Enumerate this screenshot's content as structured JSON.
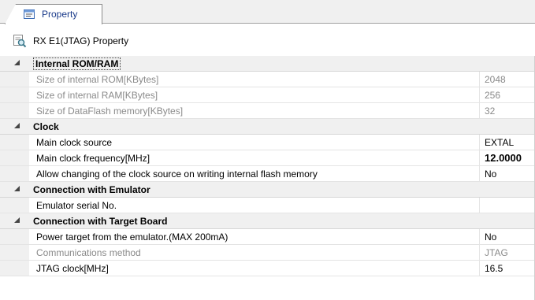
{
  "tab": {
    "label": "Property",
    "icon": "property-page-icon"
  },
  "header": {
    "title": "RX E1(JTAG) Property",
    "icon": "magnifier-property-icon"
  },
  "categories": [
    {
      "name": "Internal ROM/RAM",
      "items": [
        {
          "name": "Size of internal ROM[KBytes]",
          "value": "2048",
          "disabled": true
        },
        {
          "name": "Size of internal RAM[KBytes]",
          "value": "256",
          "disabled": true
        },
        {
          "name": "Size of DataFlash memory[KBytes]",
          "value": "32",
          "disabled": true
        }
      ]
    },
    {
      "name": "Clock",
      "items": [
        {
          "name": "Main clock source",
          "value": "EXTAL"
        },
        {
          "name": "Main clock frequency[MHz]",
          "value": "12.0000",
          "bold": true
        },
        {
          "name": "Allow changing of the clock source on writing internal flash memory",
          "value": "No"
        }
      ]
    },
    {
      "name": "Connection with Emulator",
      "items": [
        {
          "name": "Emulator serial No.",
          "value": ""
        }
      ]
    },
    {
      "name": "Connection with Target Board",
      "items": [
        {
          "name": "Power target from the emulator.(MAX 200mA)",
          "value": "No"
        },
        {
          "name": "Communications method",
          "value": "JTAG",
          "disabled": true
        },
        {
          "name": "JTAG clock[MHz]",
          "value": "16.5"
        }
      ]
    }
  ]
}
